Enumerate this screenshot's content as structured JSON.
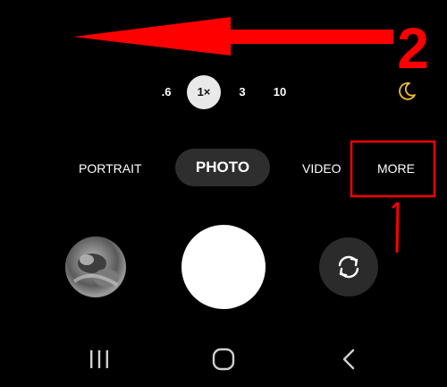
{
  "zoom": {
    "options": [
      ".6",
      "1×",
      "3",
      "10"
    ],
    "selected": "1×"
  },
  "modes": {
    "portrait": "PORTRAIT",
    "photo": "PHOTO",
    "video": "VIDEO",
    "more": "MORE",
    "selected": "PHOTO"
  },
  "annotations": {
    "label_1": "1",
    "label_2": "2",
    "color": "#ff0000"
  },
  "icons": {
    "night_mode": "crescent-moon-icon",
    "switch_camera": "camera-flip-icon",
    "nav_recents": "recents-icon",
    "nav_home": "home-icon",
    "nav_back": "back-icon"
  },
  "colors": {
    "background": "#000000",
    "moon": "#f2c12e",
    "zoom_active_bg": "#e9e9e9",
    "mode_active_bg": "#2e2e2e"
  }
}
